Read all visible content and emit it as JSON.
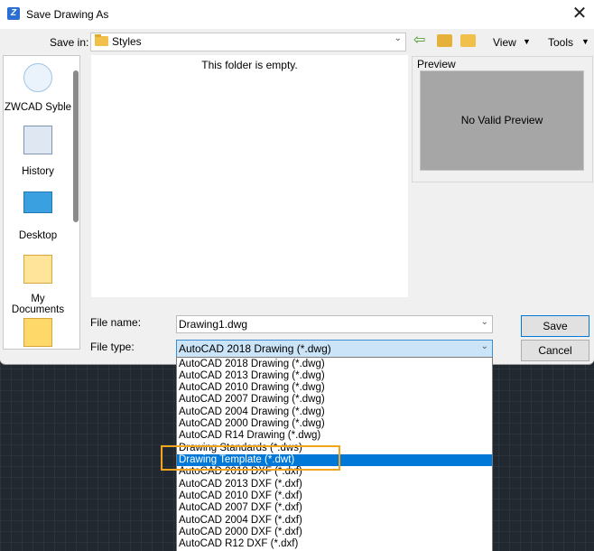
{
  "window": {
    "title": "Save Drawing As",
    "close": "✕"
  },
  "toolbar": {
    "save_in_label": "Save in:",
    "save_in_value": "Styles",
    "views_label": "View",
    "tools_label": "Tools"
  },
  "sidebar": {
    "items": [
      {
        "label": "ZWCAD Syble",
        "icon": "zwcad-styles-icon"
      },
      {
        "label": "History",
        "icon": "history-icon"
      },
      {
        "label": "Desktop",
        "icon": "desktop-icon"
      },
      {
        "label": "My Documents",
        "icon": "my-documents-icon"
      },
      {
        "label": "",
        "icon": "favorites-icon"
      }
    ]
  },
  "file_list": {
    "empty_message": "This folder is empty."
  },
  "preview": {
    "label": "Preview",
    "message": "No Valid Preview"
  },
  "form": {
    "file_name_label": "File name:",
    "file_name_value": "Drawing1.dwg",
    "file_type_label": "File type:",
    "file_type_value": "AutoCAD 2018 Drawing (*.dwg)"
  },
  "buttons": {
    "save": "Save",
    "cancel": "Cancel"
  },
  "file_type_options": [
    "AutoCAD 2018 Drawing (*.dwg)",
    "AutoCAD 2013 Drawing (*.dwg)",
    "AutoCAD 2010 Drawing (*.dwg)",
    "AutoCAD 2007 Drawing (*.dwg)",
    "AutoCAD 2004 Drawing (*.dwg)",
    "AutoCAD 2000 Drawing (*.dwg)",
    "AutoCAD R14 Drawing (*.dwg)",
    "Drawing Standards (*.dws)",
    "Drawing Template (*.dwt)",
    "AutoCAD 2018 DXF (*.dxf)",
    "AutoCAD 2013 DXF (*.dxf)",
    "AutoCAD 2010 DXF (*.dxf)",
    "AutoCAD 2007 DXF (*.dxf)",
    "AutoCAD 2004 DXF (*.dxf)",
    "AutoCAD 2000 DXF (*.dxf)",
    "AutoCAD R12 DXF (*.dxf)"
  ],
  "selected_option": "Drawing Template (*.dwt)",
  "colors": {
    "selection": "#0078d7",
    "annotation_highlight": "#f1a51d"
  }
}
